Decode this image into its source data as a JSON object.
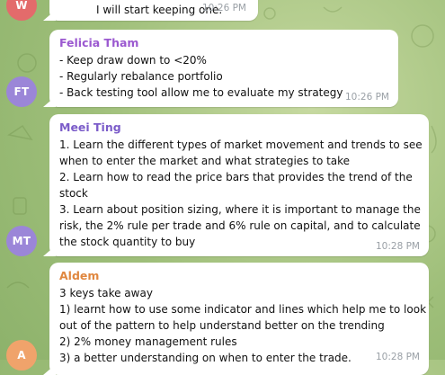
{
  "messages": [
    {
      "initials": "W",
      "avatar_color": "#e36b6b",
      "sender": "",
      "lines": [
        "I will start keeping one."
      ],
      "time": "10:26 PM"
    },
    {
      "initials": "FT",
      "avatar_color": "#9b86d8",
      "sender": "Felicia Tham",
      "sender_color": "#9b59d0",
      "lines": [
        "- Keep draw down to <20%",
        "- Regularly rebalance portfolio",
        "- Back testing tool allow me to evaluate my strategy"
      ],
      "time": "10:26 PM"
    },
    {
      "initials": "MT",
      "avatar_color": "#9b86d8",
      "sender": "Meei Ting",
      "sender_color": "#7b5cc9",
      "lines": [
        "1. Learn the different types of market movement and trends to see",
        "when to enter the market and what strategies to take",
        "2. Learn how to read the price bars that provides the trend of the",
        "stock",
        "3. Learn about position sizing, where it is important to manage the",
        "risk, the 2% rule per trade and 6% rule on capital, and to calculate",
        "the stock quantity to buy"
      ],
      "time": "10:28 PM"
    },
    {
      "initials": "A",
      "avatar_color": "#f0a36b",
      "sender": "Aldem",
      "sender_color": "#e0873f",
      "lines": [
        "3 keys take away",
        "1) learnt how to use some indicator and lines which help me to look",
        "out of the pattern to help understand better on the trending",
        "2) 2% money management rules",
        "3) a better understanding on when to enter the trade."
      ],
      "time": "10:28 PM"
    }
  ]
}
